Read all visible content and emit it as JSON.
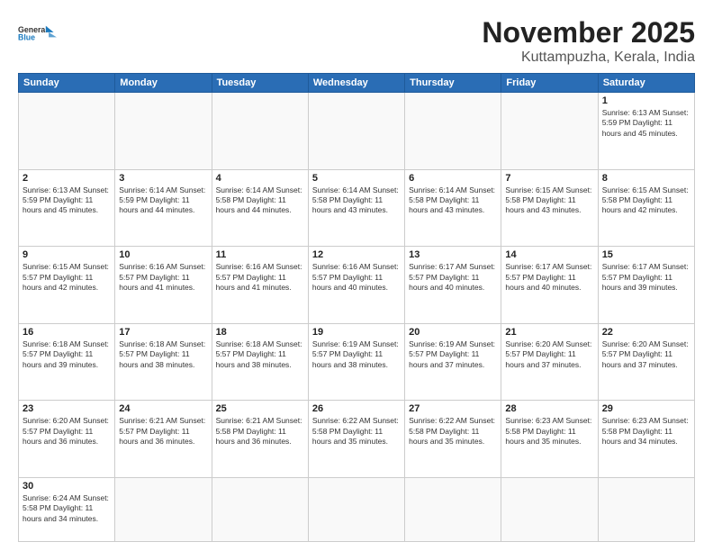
{
  "header": {
    "logo_text_general": "General",
    "logo_text_blue": "Blue",
    "title": "November 2025",
    "subtitle": "Kuttampuzha, Kerala, India"
  },
  "days_of_week": [
    "Sunday",
    "Monday",
    "Tuesday",
    "Wednesday",
    "Thursday",
    "Friday",
    "Saturday"
  ],
  "weeks": [
    [
      {
        "day": null,
        "info": null
      },
      {
        "day": null,
        "info": null
      },
      {
        "day": null,
        "info": null
      },
      {
        "day": null,
        "info": null
      },
      {
        "day": null,
        "info": null
      },
      {
        "day": null,
        "info": null
      },
      {
        "day": "1",
        "info": "Sunrise: 6:13 AM\nSunset: 5:59 PM\nDaylight: 11 hours\nand 45 minutes."
      }
    ],
    [
      {
        "day": "2",
        "info": "Sunrise: 6:13 AM\nSunset: 5:59 PM\nDaylight: 11 hours\nand 45 minutes."
      },
      {
        "day": "3",
        "info": "Sunrise: 6:14 AM\nSunset: 5:59 PM\nDaylight: 11 hours\nand 44 minutes."
      },
      {
        "day": "4",
        "info": "Sunrise: 6:14 AM\nSunset: 5:58 PM\nDaylight: 11 hours\nand 44 minutes."
      },
      {
        "day": "5",
        "info": "Sunrise: 6:14 AM\nSunset: 5:58 PM\nDaylight: 11 hours\nand 43 minutes."
      },
      {
        "day": "6",
        "info": "Sunrise: 6:14 AM\nSunset: 5:58 PM\nDaylight: 11 hours\nand 43 minutes."
      },
      {
        "day": "7",
        "info": "Sunrise: 6:15 AM\nSunset: 5:58 PM\nDaylight: 11 hours\nand 43 minutes."
      },
      {
        "day": "8",
        "info": "Sunrise: 6:15 AM\nSunset: 5:58 PM\nDaylight: 11 hours\nand 42 minutes."
      }
    ],
    [
      {
        "day": "9",
        "info": "Sunrise: 6:15 AM\nSunset: 5:57 PM\nDaylight: 11 hours\nand 42 minutes."
      },
      {
        "day": "10",
        "info": "Sunrise: 6:16 AM\nSunset: 5:57 PM\nDaylight: 11 hours\nand 41 minutes."
      },
      {
        "day": "11",
        "info": "Sunrise: 6:16 AM\nSunset: 5:57 PM\nDaylight: 11 hours\nand 41 minutes."
      },
      {
        "day": "12",
        "info": "Sunrise: 6:16 AM\nSunset: 5:57 PM\nDaylight: 11 hours\nand 40 minutes."
      },
      {
        "day": "13",
        "info": "Sunrise: 6:17 AM\nSunset: 5:57 PM\nDaylight: 11 hours\nand 40 minutes."
      },
      {
        "day": "14",
        "info": "Sunrise: 6:17 AM\nSunset: 5:57 PM\nDaylight: 11 hours\nand 40 minutes."
      },
      {
        "day": "15",
        "info": "Sunrise: 6:17 AM\nSunset: 5:57 PM\nDaylight: 11 hours\nand 39 minutes."
      }
    ],
    [
      {
        "day": "16",
        "info": "Sunrise: 6:18 AM\nSunset: 5:57 PM\nDaylight: 11 hours\nand 39 minutes."
      },
      {
        "day": "17",
        "info": "Sunrise: 6:18 AM\nSunset: 5:57 PM\nDaylight: 11 hours\nand 38 minutes."
      },
      {
        "day": "18",
        "info": "Sunrise: 6:18 AM\nSunset: 5:57 PM\nDaylight: 11 hours\nand 38 minutes."
      },
      {
        "day": "19",
        "info": "Sunrise: 6:19 AM\nSunset: 5:57 PM\nDaylight: 11 hours\nand 38 minutes."
      },
      {
        "day": "20",
        "info": "Sunrise: 6:19 AM\nSunset: 5:57 PM\nDaylight: 11 hours\nand 37 minutes."
      },
      {
        "day": "21",
        "info": "Sunrise: 6:20 AM\nSunset: 5:57 PM\nDaylight: 11 hours\nand 37 minutes."
      },
      {
        "day": "22",
        "info": "Sunrise: 6:20 AM\nSunset: 5:57 PM\nDaylight: 11 hours\nand 37 minutes."
      }
    ],
    [
      {
        "day": "23",
        "info": "Sunrise: 6:20 AM\nSunset: 5:57 PM\nDaylight: 11 hours\nand 36 minutes."
      },
      {
        "day": "24",
        "info": "Sunrise: 6:21 AM\nSunset: 5:57 PM\nDaylight: 11 hours\nand 36 minutes."
      },
      {
        "day": "25",
        "info": "Sunrise: 6:21 AM\nSunset: 5:58 PM\nDaylight: 11 hours\nand 36 minutes."
      },
      {
        "day": "26",
        "info": "Sunrise: 6:22 AM\nSunset: 5:58 PM\nDaylight: 11 hours\nand 35 minutes."
      },
      {
        "day": "27",
        "info": "Sunrise: 6:22 AM\nSunset: 5:58 PM\nDaylight: 11 hours\nand 35 minutes."
      },
      {
        "day": "28",
        "info": "Sunrise: 6:23 AM\nSunset: 5:58 PM\nDaylight: 11 hours\nand 35 minutes."
      },
      {
        "day": "29",
        "info": "Sunrise: 6:23 AM\nSunset: 5:58 PM\nDaylight: 11 hours\nand 34 minutes."
      }
    ],
    [
      {
        "day": "30",
        "info": "Sunrise: 6:24 AM\nSunset: 5:58 PM\nDaylight: 11 hours\nand 34 minutes."
      },
      {
        "day": null,
        "info": null
      },
      {
        "day": null,
        "info": null
      },
      {
        "day": null,
        "info": null
      },
      {
        "day": null,
        "info": null
      },
      {
        "day": null,
        "info": null
      },
      {
        "day": null,
        "info": null
      }
    ]
  ]
}
